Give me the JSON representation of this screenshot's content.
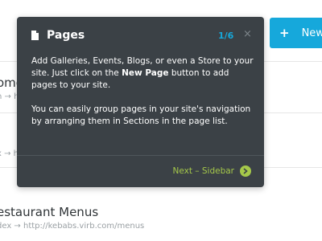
{
  "new_button": {
    "icon": "plus-icon",
    "label": "New"
  },
  "page_list": [
    {
      "title": "ome",
      "url": "n → ht"
    },
    {
      "url": "x → htt"
    },
    {
      "title": "estaurant Menus",
      "url": "dex → http://kebabs.virb.com/menus"
    }
  ],
  "tour": {
    "icon": "document-icon",
    "title": "Pages",
    "step": "1/6",
    "close": "×",
    "body": {
      "p1_a": "Add Galleries, Events, Blogs, or even a Store to your site. Just click on the ",
      "p1_bold": "New Page",
      "p1_b": " button to add pages to your site.",
      "p2": "You can easily group pages in your site's navigation by arranging them in Sections in the page list."
    },
    "next_label": "Next – Sidebar",
    "next_icon": "chevron-right-icon"
  },
  "colors": {
    "accent_blue": "#16a8db",
    "popover_bg": "#3b4146",
    "next_green": "#a5c84a"
  }
}
